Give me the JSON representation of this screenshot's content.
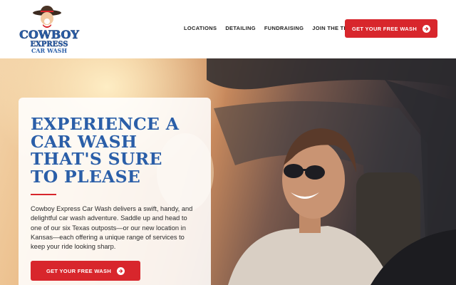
{
  "brand": {
    "logo_line1": "COWBOY",
    "logo_line2": "EXPRESS",
    "logo_line3": "CAR WASH",
    "primary_color": "#2a5ea8",
    "accent_color": "#d8262c"
  },
  "nav": {
    "items": [
      {
        "label": "LOCATIONS"
      },
      {
        "label": "DETAILING"
      },
      {
        "label": "FUNDRAISING"
      },
      {
        "label": "JOIN THE TEAM"
      }
    ],
    "cta_label": "GET YOUR FREE WASH",
    "cta_icon": "arrow-right-circle-icon"
  },
  "hero": {
    "headline_lines": [
      "EXPERIENCE A",
      "CAR WASH",
      "THAT'S SURE",
      "TO PLEASE"
    ],
    "body": "Cowboy Express Car Wash delivers a swift, handy, and delightful car wash adventure. Saddle up and head to one of our six Texas outposts—or our new location in Kansas—each offering a unique range of services to keep your ride looking sharp.",
    "cta_label": "GET YOUR FREE WASH",
    "cta_icon": "arrow-right-circle-icon",
    "image": "photo of smiling man with sunglasses driving a car with a woman passenger"
  }
}
